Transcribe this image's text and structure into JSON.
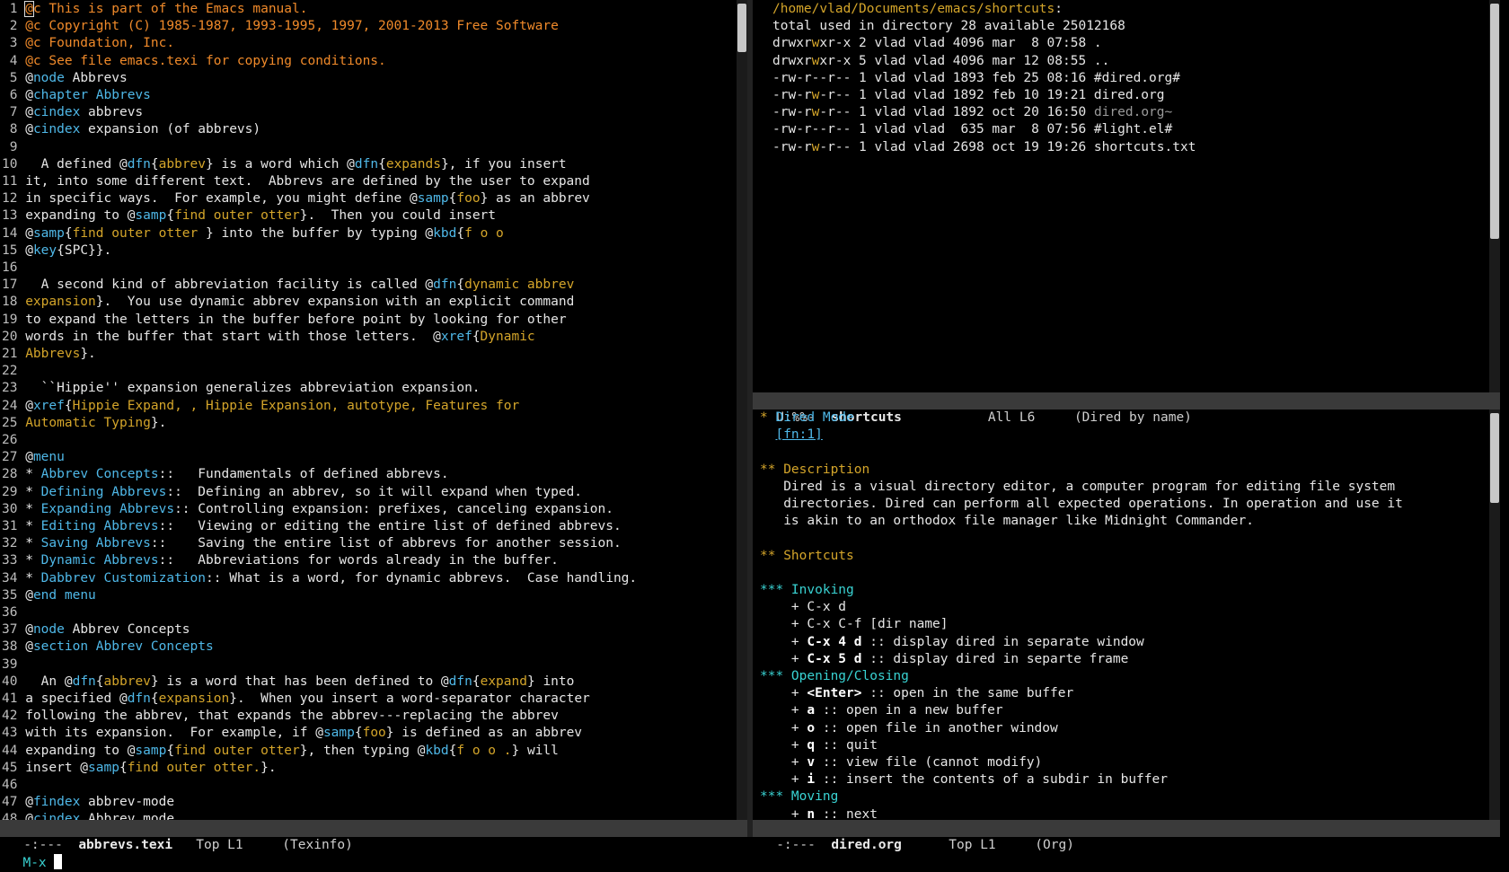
{
  "colors": {
    "background": "#000000",
    "comment": "#f08a2a",
    "keyword": "#4fb8e8",
    "string": "#d4a52a",
    "cyan": "#39d2d2",
    "org_bullet": "#d4a52a",
    "org_heading": "#39d2d2",
    "link": "#4fb8e8",
    "modeline_bg": "#3a3a3a",
    "text": "#e6e6e6",
    "dim": "#9a9a9a"
  },
  "left": {
    "lines": [
      [
        [
          "@c This is part of the Emacs manual.",
          "c"
        ]
      ],
      [
        [
          "@c Copyright (C) 1985-1987, 1993-1995, 1997, 2001-2013 Free Software",
          "c"
        ]
      ],
      [
        [
          "@c Foundation, Inc.",
          "c"
        ]
      ],
      [
        [
          "@c See file emacs.texi for copying conditions.",
          "c"
        ]
      ],
      [
        [
          "@",
          "t"
        ],
        [
          "node",
          "k"
        ],
        [
          " Abbrevs",
          "t"
        ]
      ],
      [
        [
          "@",
          "t"
        ],
        [
          "chapter Abbrevs",
          "k"
        ]
      ],
      [
        [
          "@",
          "t"
        ],
        [
          "cindex",
          "k"
        ],
        [
          " abbrevs",
          "t"
        ]
      ],
      [
        [
          "@",
          "t"
        ],
        [
          "cindex",
          "k"
        ],
        [
          " expansion (of abbrevs)",
          "t"
        ]
      ],
      [],
      [
        [
          "  A defined @",
          "t"
        ],
        [
          "dfn",
          "k"
        ],
        [
          "{",
          "t"
        ],
        [
          "abbrev",
          "s"
        ],
        [
          "} is a word which @",
          "t"
        ],
        [
          "dfn",
          "k"
        ],
        [
          "{",
          "t"
        ],
        [
          "expands",
          "s"
        ],
        [
          "}, if you insert",
          "t"
        ]
      ],
      [
        [
          "it, into some different text.  Abbrevs are defined by the user to expand",
          "t"
        ]
      ],
      [
        [
          "in specific ways.  For example, you might define @",
          "t"
        ],
        [
          "samp",
          "k"
        ],
        [
          "{",
          "t"
        ],
        [
          "foo",
          "s"
        ],
        [
          "} as an abbrev",
          "t"
        ]
      ],
      [
        [
          "expanding to @",
          "t"
        ],
        [
          "samp",
          "k"
        ],
        [
          "{",
          "t"
        ],
        [
          "find outer otter",
          "s"
        ],
        [
          "}.  Then you could insert",
          "t"
        ]
      ],
      [
        [
          "@",
          "t"
        ],
        [
          "samp",
          "k"
        ],
        [
          "{",
          "t"
        ],
        [
          "find outer otter ",
          "s"
        ],
        [
          "} into the buffer by typing @",
          "t"
        ],
        [
          "kbd",
          "k"
        ],
        [
          "{",
          "t"
        ],
        [
          "f o o",
          "s"
        ]
      ],
      [
        [
          "@",
          "t"
        ],
        [
          "key",
          "k"
        ],
        [
          "{SPC}}.",
          "t"
        ]
      ],
      [],
      [
        [
          "  A second kind of abbreviation facility is called @",
          "t"
        ],
        [
          "dfn",
          "k"
        ],
        [
          "{",
          "t"
        ],
        [
          "dynamic abbrev",
          "s"
        ]
      ],
      [
        [
          "expansion",
          "s"
        ],
        [
          "}.  You use dynamic abbrev expansion with an explicit command",
          "t"
        ]
      ],
      [
        [
          "to expand the letters in the buffer before point by looking for other",
          "t"
        ]
      ],
      [
        [
          "words in the buffer that start with those letters.  @",
          "t"
        ],
        [
          "xref",
          "k"
        ],
        [
          "{",
          "t"
        ],
        [
          "Dynamic",
          "s"
        ]
      ],
      [
        [
          "Abbrevs",
          "s"
        ],
        [
          "}.",
          "t"
        ]
      ],
      [],
      [
        [
          "  ``Hippie'' expansion generalizes abbreviation expansion.",
          "t"
        ]
      ],
      [
        [
          "@",
          "t"
        ],
        [
          "xref",
          "k"
        ],
        [
          "{",
          "t"
        ],
        [
          "Hippie Expand, , Hippie Expansion, autotype, Features for",
          "s"
        ]
      ],
      [
        [
          "Automatic Typing",
          "s"
        ],
        [
          "}.",
          "t"
        ]
      ],
      [],
      [
        [
          "@",
          "t"
        ],
        [
          "menu",
          "k"
        ]
      ],
      [
        [
          "* ",
          "t"
        ],
        [
          "Abbrev Concepts",
          "l"
        ],
        [
          "::   Fundamentals of defined abbrevs.",
          "t"
        ]
      ],
      [
        [
          "* ",
          "t"
        ],
        [
          "Defining Abbrevs",
          "l"
        ],
        [
          "::  Defining an abbrev, so it will expand when typed.",
          "t"
        ]
      ],
      [
        [
          "* ",
          "t"
        ],
        [
          "Expanding Abbrevs",
          "l"
        ],
        [
          ":: Controlling expansion: prefixes, canceling expansion.",
          "t"
        ]
      ],
      [
        [
          "* ",
          "t"
        ],
        [
          "Editing Abbrevs",
          "l"
        ],
        [
          "::   Viewing or editing the entire list of defined abbrevs.",
          "t"
        ]
      ],
      [
        [
          "* ",
          "t"
        ],
        [
          "Saving Abbrevs",
          "l"
        ],
        [
          "::    Saving the entire list of abbrevs for another session.",
          "t"
        ]
      ],
      [
        [
          "* ",
          "t"
        ],
        [
          "Dynamic Abbrevs",
          "l"
        ],
        [
          "::   Abbreviations for words already in the buffer.",
          "t"
        ]
      ],
      [
        [
          "* ",
          "t"
        ],
        [
          "Dabbrev Customization",
          "l"
        ],
        [
          ":: What is a word, for dynamic abbrevs.  Case handling.",
          "t"
        ]
      ],
      [
        [
          "@",
          "t"
        ],
        [
          "end menu",
          "k"
        ]
      ],
      [],
      [
        [
          "@",
          "t"
        ],
        [
          "node",
          "k"
        ],
        [
          " Abbrev Concepts",
          "t"
        ]
      ],
      [
        [
          "@",
          "t"
        ],
        [
          "section Abbrev Concepts",
          "k"
        ]
      ],
      [],
      [
        [
          "  An @",
          "t"
        ],
        [
          "dfn",
          "k"
        ],
        [
          "{",
          "t"
        ],
        [
          "abbrev",
          "s"
        ],
        [
          "} is a word that has been defined to @",
          "t"
        ],
        [
          "dfn",
          "k"
        ],
        [
          "{",
          "t"
        ],
        [
          "expand",
          "s"
        ],
        [
          "} into",
          "t"
        ]
      ],
      [
        [
          "a specified @",
          "t"
        ],
        [
          "dfn",
          "k"
        ],
        [
          "{",
          "t"
        ],
        [
          "expansion",
          "s"
        ],
        [
          "}.  When you insert a word-separator character",
          "t"
        ]
      ],
      [
        [
          "following the abbrev, that expands the abbrev---replacing the abbrev",
          "t"
        ]
      ],
      [
        [
          "with its expansion.  For example, if @",
          "t"
        ],
        [
          "samp",
          "k"
        ],
        [
          "{",
          "t"
        ],
        [
          "foo",
          "s"
        ],
        [
          "} is defined as an abbrev",
          "t"
        ]
      ],
      [
        [
          "expanding to @",
          "t"
        ],
        [
          "samp",
          "k"
        ],
        [
          "{",
          "t"
        ],
        [
          "find outer otter",
          "s"
        ],
        [
          "}, then typing @",
          "t"
        ],
        [
          "kbd",
          "k"
        ],
        [
          "{",
          "t"
        ],
        [
          "f o o .",
          "s"
        ],
        [
          "} will",
          "t"
        ]
      ],
      [
        [
          "insert @",
          "t"
        ],
        [
          "samp",
          "k"
        ],
        [
          "{",
          "t"
        ],
        [
          "find outer otter.",
          "s"
        ],
        [
          "}.",
          "t"
        ]
      ],
      [],
      [
        [
          "@",
          "t"
        ],
        [
          "findex",
          "k"
        ],
        [
          " abbrev-mode",
          "t"
        ]
      ],
      [
        [
          "@",
          "t"
        ],
        [
          "cindex",
          "k"
        ],
        [
          " Abbrev mode",
          "t"
        ]
      ]
    ],
    "modeline": {
      "state": " -:---  ",
      "buffer": "abbrevs.texi",
      "pos": "   Top L1     ",
      "mode": "(Texinfo)"
    }
  },
  "dired": {
    "lines": [
      [
        [
          "/home/vlad/Documents/emacs/shortcuts",
          "s"
        ],
        [
          ":",
          "t"
        ]
      ],
      [
        [
          "total used in directory 28 available 25012168",
          "t"
        ]
      ],
      [
        [
          "drwxr",
          "t"
        ],
        [
          "w",
          "s"
        ],
        [
          "xr-x 2 vlad vlad 4096 mar  8 07:58 .",
          "t"
        ]
      ],
      [
        [
          "drwxr",
          "t"
        ],
        [
          "w",
          "s"
        ],
        [
          "xr-x 5 vlad vlad 4096 mar 12 08:55 ..",
          "t"
        ]
      ],
      [
        [
          "-rw-r--r-- 1 vlad vlad 1893 feb 25 08:16 #dired.org#",
          "t"
        ]
      ],
      [
        [
          "-rw-r",
          "t"
        ],
        [
          "w",
          "s"
        ],
        [
          "-r-- 1 vlad vlad 1892 feb 10 19:21 dired.org",
          "t"
        ]
      ],
      [
        [
          "-rw-r",
          "t"
        ],
        [
          "w",
          "s"
        ],
        [
          "-r-- 1 vlad vlad 1892 oct 20 16:50 ",
          "t"
        ],
        [
          "dired.org~",
          "d"
        ]
      ],
      [
        [
          "-rw-r--r-- 1 vlad vlad  635 mar  8 07:56 #light.el#",
          "t"
        ]
      ],
      [
        [
          "-rw-r",
          "t"
        ],
        [
          "w",
          "s"
        ],
        [
          "-r-- 1 vlad vlad 2698 oct 19 19:26 shortcuts.txt",
          "t"
        ]
      ]
    ],
    "modeline": {
      "state": " U:%%-  ",
      "buffer": "shortcuts",
      "pos": "           All L6     ",
      "mode": "(Dired by name)"
    }
  },
  "org": {
    "lines": [
      [
        [
          "* ",
          "ob"
        ],
        [
          "Dired Mode",
          "oh"
        ]
      ],
      [
        [
          "  ",
          "t"
        ],
        [
          "[fn:1]",
          "ul"
        ]
      ],
      [],
      [
        [
          "** ",
          "ob"
        ],
        [
          "Description",
          "s"
        ]
      ],
      [
        [
          "   Dired is a visual directory editor, a computer program for editing file system",
          "t"
        ]
      ],
      [
        [
          "   directories. Dired can perform all expected operations. In operation and use it",
          "t"
        ]
      ],
      [
        [
          "   is akin to an orthodox file manager like Midnight Commander.",
          "t"
        ]
      ],
      [],
      [
        [
          "** ",
          "ob"
        ],
        [
          "Shortcuts",
          "s"
        ]
      ],
      [],
      [
        [
          "*** ",
          "c3"
        ],
        [
          "Invoking",
          "c3"
        ]
      ],
      [
        [
          "    + C-x d",
          "t"
        ]
      ],
      [
        [
          "    + C-x C-f [dir name]",
          "t"
        ]
      ],
      [
        [
          "    + ",
          "t"
        ],
        [
          "C-x 4 d",
          "b"
        ],
        [
          " :: display dired in separate window",
          "t"
        ]
      ],
      [
        [
          "    + ",
          "t"
        ],
        [
          "C-x 5 d",
          "b"
        ],
        [
          " :: display dired in separte frame",
          "t"
        ]
      ],
      [
        [
          "*** ",
          "c3"
        ],
        [
          "Opening/Closing",
          "c3"
        ]
      ],
      [
        [
          "    + ",
          "t"
        ],
        [
          "<Enter>",
          "b"
        ],
        [
          " :: open in the same buffer",
          "t"
        ]
      ],
      [
        [
          "    + ",
          "t"
        ],
        [
          "a",
          "b"
        ],
        [
          " :: open in a new buffer",
          "t"
        ]
      ],
      [
        [
          "    + ",
          "t"
        ],
        [
          "o",
          "b"
        ],
        [
          " :: open file in another window",
          "t"
        ]
      ],
      [
        [
          "    + ",
          "t"
        ],
        [
          "q",
          "b"
        ],
        [
          " :: quit",
          "t"
        ]
      ],
      [
        [
          "    + ",
          "t"
        ],
        [
          "v",
          "b"
        ],
        [
          " :: view file (cannot modify)",
          "t"
        ]
      ],
      [
        [
          "    + ",
          "t"
        ],
        [
          "i",
          "b"
        ],
        [
          " :: insert the contents of a subdir in buffer",
          "t"
        ]
      ],
      [
        [
          "*** ",
          "c3"
        ],
        [
          "Moving",
          "c3"
        ]
      ],
      [
        [
          "    + ",
          "t"
        ],
        [
          "n",
          "b"
        ],
        [
          " :: next",
          "t"
        ]
      ]
    ],
    "modeline": {
      "state": " -:---  ",
      "buffer": "dired.org",
      "pos": "      Top L1     ",
      "mode": "(Org)"
    }
  },
  "minibuffer": {
    "prompt": "M-x"
  }
}
